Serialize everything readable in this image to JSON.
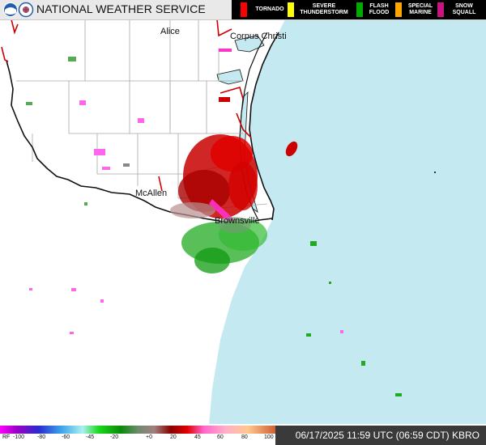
{
  "header": {
    "agency": "NATIONAL WEATHER SERVICE",
    "logos": [
      "noaa-logo",
      "nws-logo"
    ]
  },
  "legend": [
    {
      "label": "TORNADO",
      "color": "#ff0000"
    },
    {
      "label": "SEVERE THUNDERSTORM",
      "color": "#ffff00"
    },
    {
      "label": "FLASH FLOOD",
      "color": "#00aa00"
    },
    {
      "label": "SPECIAL MARINE",
      "color": "#ffa500"
    },
    {
      "label": "SNOW SQUALL",
      "color": "#c71585"
    }
  ],
  "map": {
    "cities": [
      "Alice",
      "Corpus Christi",
      "McAllen",
      "Brownsville"
    ],
    "colors": {
      "land": "#ffffff",
      "water": "#c5e9f1",
      "border": "#111111",
      "county": "#a8a8a8",
      "warning": "#cc0000"
    }
  },
  "scale": {
    "prefix": "RF",
    "labels": [
      "-100",
      "-80",
      "-60",
      "-45",
      "-20",
      "+0",
      "20",
      "45",
      "60",
      "80",
      "100"
    ]
  },
  "timestamp": "06/17/2025 11:59 UTC (06:59 CDT) KBRO"
}
